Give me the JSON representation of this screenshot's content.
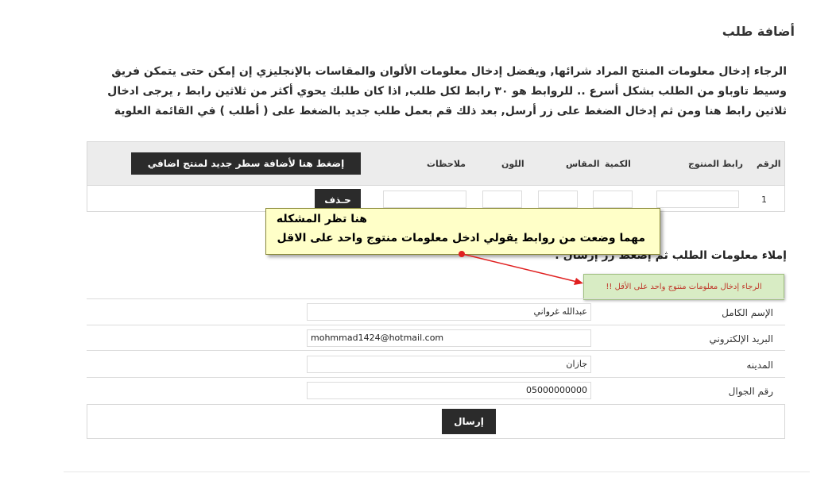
{
  "page": {
    "title": "أضافة طلب",
    "intro": "الرجاء إدخال معلومات المنتج المراد شرائها, ويفضل إدخال معلومات الألوان والمقاسات بالإنجليزي إن إمكن حتى يتمكن فريق وسيط تاوباو من الطلب بشكل أسرع .. للروابط هو ٣٠ رابط لكل طلب, اذا كان طلبك يحوي أكثر من ثلاثين رابط , يرجى ادخال ثلاثين رابط هنا ومن ثم إدخال الضغط على زر أرسل, بعد ذلك قم بعمل طلب جديد بالضغط على ( أطلب ) في القائمة العلوية"
  },
  "products_table": {
    "headers": {
      "number": "الرقم",
      "link": "رابط المنتوج",
      "quantity": "الكمية",
      "size": "المقاس",
      "color": "اللون",
      "notes": "ملاحظات"
    },
    "add_row_label": "إضغط هنا لأضافة سطر جديد لمنتج اضافي",
    "rows": [
      {
        "number": "1",
        "link": "",
        "quantity": "",
        "size": "",
        "color": "",
        "notes": "",
        "delete_label": "حـذف"
      }
    ]
  },
  "annotation": {
    "line1": "هنا تظر المشكله",
    "line2": "مهما وضعت من روابط يقولي ادخل معلومات منتوج واحد على الاقل",
    "arrow_color": "#e02020"
  },
  "form": {
    "heading": "إملاء معلومات الطلب ثم إضغط زر إرسال :",
    "error_message": "الرجاء إدخال معلومات منتوج واحد على الأقل !!",
    "fields": [
      {
        "label": "الإسم الكامل",
        "value": "عبدالله غرواني"
      },
      {
        "label": "البريد الإلكتروني",
        "value": "mohmmad1424@hotmail.com"
      },
      {
        "label": "المدينه",
        "value": "جازان"
      },
      {
        "label": "رقم الجوال",
        "value": "05000000000"
      }
    ],
    "submit_label": "إرسال"
  }
}
